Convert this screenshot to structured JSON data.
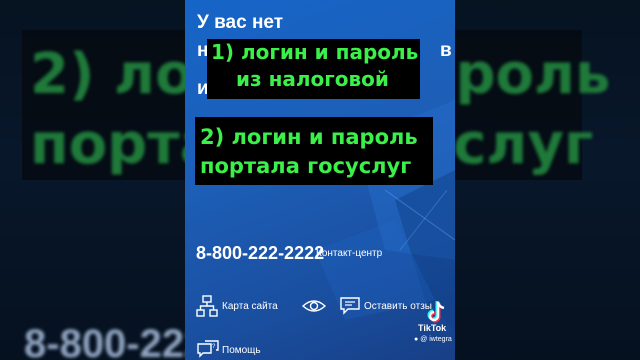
{
  "video": {
    "header_lines": [
      "У вас нет",
      "н",
      "и"
    ],
    "header_tail": "в",
    "caption1": [
      "1) логин и пароль",
      "из налоговой"
    ],
    "caption2": [
      "2) логин и пароль",
      "портала госуслуг"
    ],
    "phone": "8-800-222-2222",
    "contact_label": "Контакт-центр",
    "footer": {
      "sitemap": "Карта сайта",
      "feedback": "Оставить отзы",
      "help": "Помощь"
    }
  },
  "background": {
    "line1": "2) логин и пароль",
    "line2": "портала госуслуг",
    "phone": "8-800-222"
  },
  "watermark": {
    "brand": "TikTok",
    "user": "@ iwtegra"
  },
  "colors": {
    "caption_text": "#3cf04a",
    "caption_bg": "#000000",
    "frame_blue": "#1d5fb8"
  }
}
